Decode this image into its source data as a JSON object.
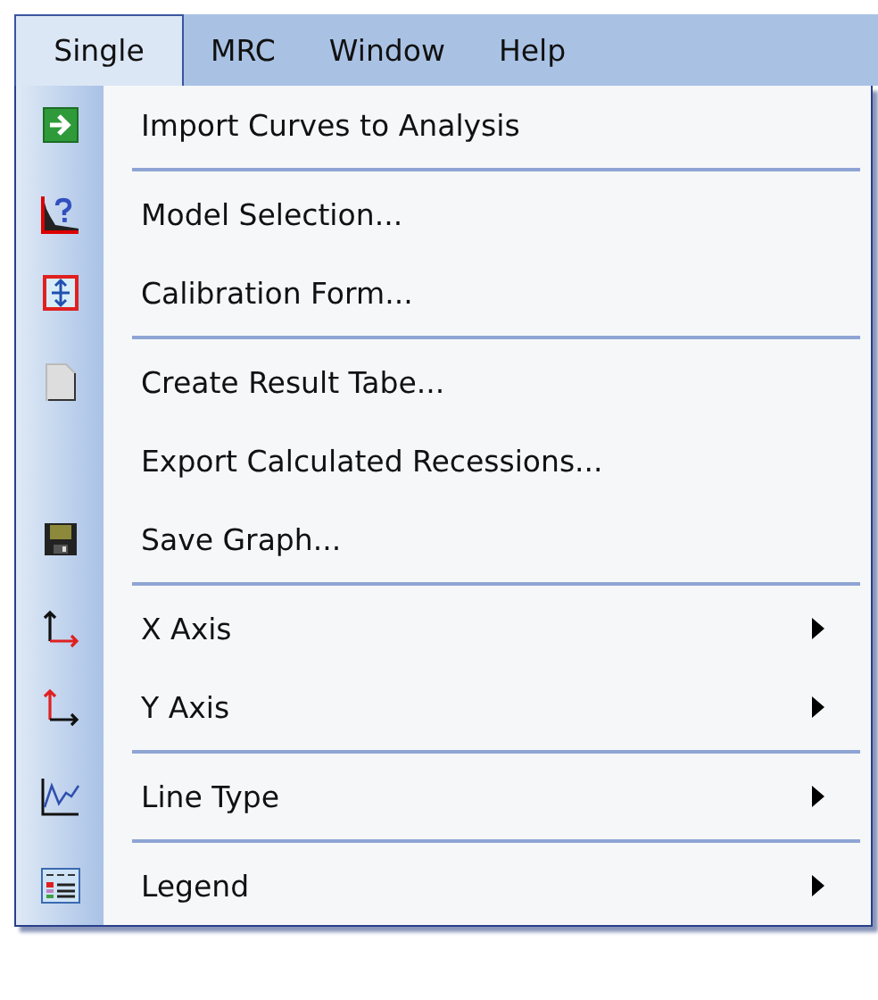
{
  "menu_bar": [
    {
      "label": "Single",
      "selected": true
    },
    {
      "label": "MRC",
      "selected": false
    },
    {
      "label": "Window",
      "selected": false
    },
    {
      "label": "Help",
      "selected": false
    }
  ],
  "menu": [
    {
      "kind": "item",
      "label": "Import Curves to Analysis",
      "submenu": false
    },
    {
      "kind": "separator"
    },
    {
      "kind": "item",
      "label": "Model Selection...",
      "submenu": false
    },
    {
      "kind": "item",
      "label": "Calibration Form...",
      "submenu": false
    },
    {
      "kind": "separator"
    },
    {
      "kind": "item",
      "label": "Create Result Tabe...",
      "submenu": false
    },
    {
      "kind": "item",
      "label": "Export Calculated Recessions...",
      "submenu": false
    },
    {
      "kind": "item",
      "label": "Save Graph...",
      "submenu": false
    },
    {
      "kind": "separator"
    },
    {
      "kind": "item",
      "label": "X Axis",
      "submenu": true
    },
    {
      "kind": "item",
      "label": "Y Axis",
      "submenu": true
    },
    {
      "kind": "separator"
    },
    {
      "kind": "item",
      "label": "Line Type",
      "submenu": true
    },
    {
      "kind": "separator"
    },
    {
      "kind": "item",
      "label": "Legend",
      "submenu": true
    }
  ]
}
